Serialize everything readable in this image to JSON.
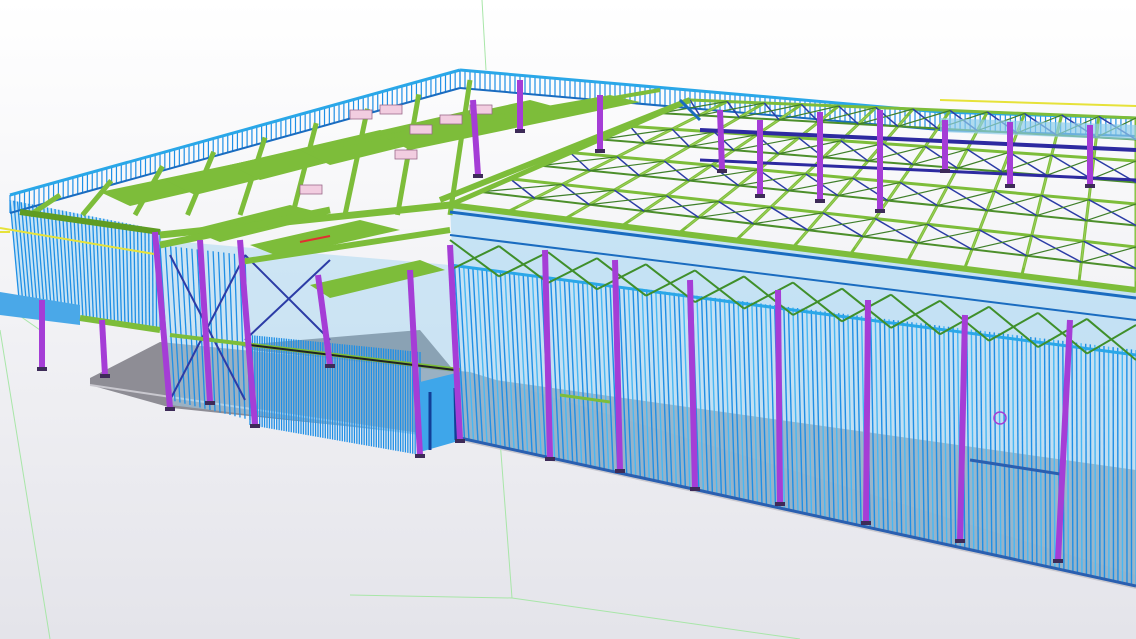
{
  "scene": {
    "type": "3d-structural-model-view",
    "colors": {
      "background_top": "#ffffff",
      "background_bottom": "#e4e4ea",
      "grid_line": "#a8e6a8",
      "floor_slab": "#8e8d95",
      "floor_edge": "#c9c8cf",
      "steel_column": "#a53dd6",
      "light_gauge_stud": "#1e8fe6",
      "stud_highlight": "#47b8f5",
      "joist_beam": "#7dbd3a",
      "joist_beam_dark": "#5f9c22",
      "bracing": "#2c3ca6",
      "top_track": "#2aa7e8",
      "accent_yellow": "#e6e23a"
    }
  }
}
